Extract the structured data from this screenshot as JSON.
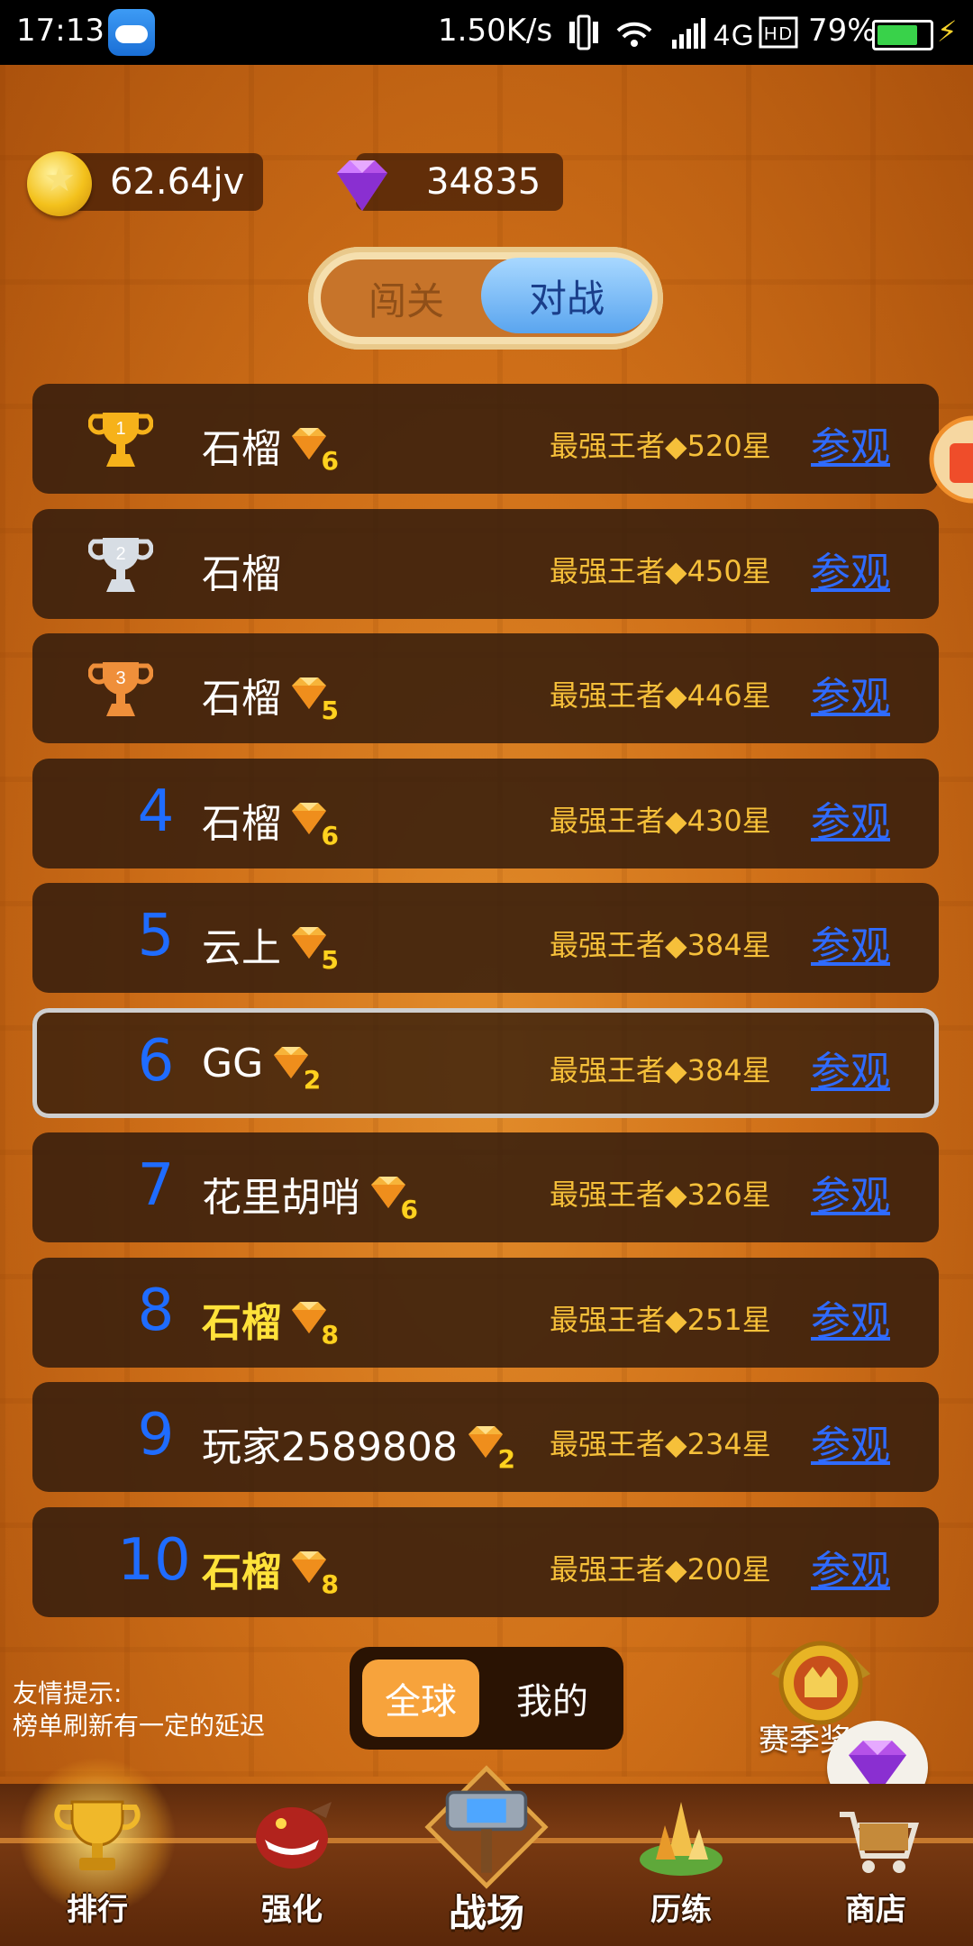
{
  "status_bar": {
    "time": "17:13",
    "speed": "1.50K/s",
    "network": "4G",
    "battery": "79%",
    "battery_level": 0.79
  },
  "currency": {
    "coins": "62.64jv",
    "gems": "34835"
  },
  "mode_toggle": {
    "left": "闯关",
    "right": "对战",
    "selected": "对战"
  },
  "ranking": [
    {
      "rank": "1",
      "name": "石榴",
      "vip": "6",
      "title": "最强王者◆520星",
      "action": "参观",
      "trophy": "gold"
    },
    {
      "rank": "2",
      "name": "石榴",
      "vip": "",
      "title": "最强王者◆450星",
      "action": "参观",
      "trophy": "silver"
    },
    {
      "rank": "3",
      "name": "石榴",
      "vip": "5",
      "title": "最强王者◆446星",
      "action": "参观",
      "trophy": "bronze"
    },
    {
      "rank": "4",
      "name": "石榴",
      "vip": "6",
      "title": "最强王者◆430星",
      "action": "参观"
    },
    {
      "rank": "5",
      "name": "云上",
      "vip": "5",
      "title": "最强王者◆384星",
      "action": "参观"
    },
    {
      "rank": "6",
      "name": "GG",
      "vip": "2",
      "title": "最强王者◆384星",
      "action": "参观",
      "highlight": true
    },
    {
      "rank": "7",
      "name": "花里胡哨",
      "vip": "6",
      "title": "最强王者◆326星",
      "action": "参观"
    },
    {
      "rank": "8",
      "name": "石榴",
      "vip": "8",
      "title": "最强王者◆251星",
      "action": "参观",
      "gold_name": true
    },
    {
      "rank": "9",
      "name": "玩家2589808",
      "vip": "2",
      "title": "最强王者◆234星",
      "action": "参观"
    },
    {
      "rank": "10",
      "name": "石榴",
      "vip": "8",
      "title": "最强王者◆200星",
      "action": "参观",
      "gold_name": true
    }
  ],
  "tip": {
    "line1": "友情提示:",
    "line2": "榜单刷新有一定的延迟"
  },
  "scope_toggle": {
    "global": "全球",
    "mine": "我的",
    "selected": "全球"
  },
  "season": {
    "label": "赛季奖"
  },
  "bottom_nav": [
    {
      "label": "排行",
      "icon": "trophy-icon",
      "active": true
    },
    {
      "label": "强化",
      "icon": "monster-icon"
    },
    {
      "label": "战场",
      "icon": "hammer-icon"
    },
    {
      "label": "历练",
      "icon": "crystal-island-icon"
    },
    {
      "label": "商店",
      "icon": "cart-icon"
    }
  ],
  "colors": {
    "rank_number": "#1f6cff",
    "title_text": "#f6c03a",
    "watch_link": "#2f6bff",
    "gold_name": "#ffe23a"
  }
}
